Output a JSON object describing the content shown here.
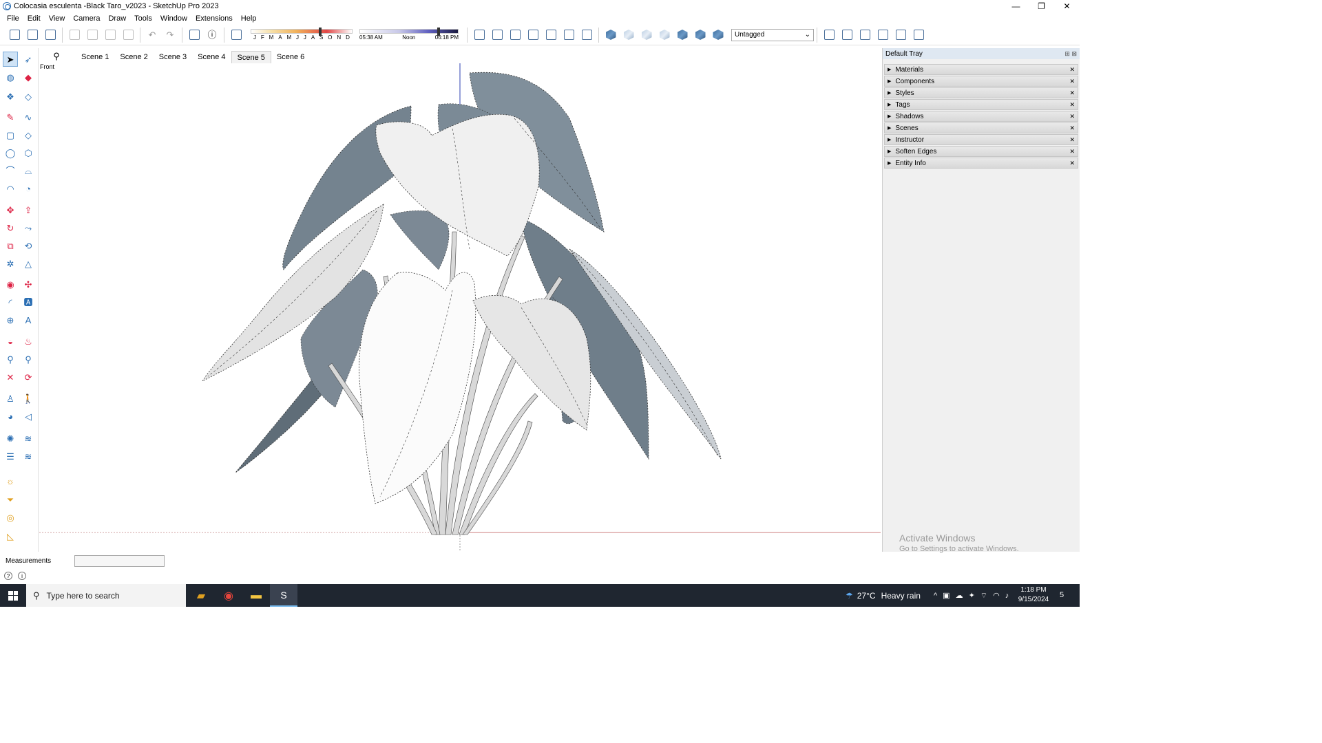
{
  "window": {
    "title": "Colocasia esculenta -Black Taro_v2023 - SketchUp Pro 2023",
    "minimize": "—",
    "restore": "❐",
    "close": "✕"
  },
  "menu": [
    "File",
    "Edit",
    "View",
    "Camera",
    "Draw",
    "Tools",
    "Window",
    "Extensions",
    "Help"
  ],
  "toolbar": {
    "months": [
      "J",
      "F",
      "M",
      "A",
      "M",
      "J",
      "J",
      "A",
      "S",
      "O",
      "N",
      "D"
    ],
    "shadow_month_fraction": 0.67,
    "time_fraction": 0.79,
    "time_start": "05:38 AM",
    "time_mid": "Noon",
    "time_end": "06:18 PM",
    "tag_value": "Untagged"
  },
  "scenes": {
    "tabs": [
      "Scene 1",
      "Scene 2",
      "Scene 3",
      "Scene 4",
      "Scene 5",
      "Scene 6"
    ],
    "active_index": 4
  },
  "viewport": {
    "view_label": "Front"
  },
  "tray": {
    "title": "Default Tray",
    "items": [
      "Materials",
      "Components",
      "Styles",
      "Tags",
      "Shadows",
      "Scenes",
      "Instructor",
      "Soften Edges",
      "Entity Info"
    ]
  },
  "watermark": {
    "line1": "Activate Windows",
    "line2": "Go to Settings to activate Windows."
  },
  "measurements": {
    "label": "Measurements",
    "value": ""
  },
  "taskbar": {
    "search_placeholder": "Type here to search",
    "temperature": "27°C",
    "weather": "Heavy rain",
    "time": "1:18 PM",
    "date": "9/15/2024",
    "notification_count": "5"
  },
  "colors": {
    "leaf_dark": "#7d8b97",
    "leaf_light": "#f2f2f2",
    "accent": "#1f86d6",
    "taskbar": "#1f2630"
  }
}
